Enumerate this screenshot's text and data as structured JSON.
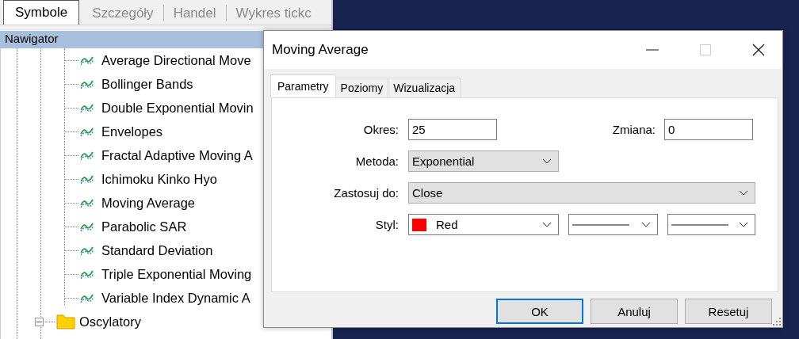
{
  "top_tabs": [
    {
      "label": "Symbole",
      "selected": true
    },
    {
      "label": "Szczegóły",
      "selected": false
    },
    {
      "label": "Handel",
      "selected": false
    },
    {
      "label": "Wykres tickc",
      "selected": false
    }
  ],
  "navigator": {
    "title": "Nawigator",
    "items": [
      {
        "kind": "indicator",
        "label": "Average Directional Move"
      },
      {
        "kind": "indicator",
        "label": "Bollinger Bands"
      },
      {
        "kind": "indicator",
        "label": "Double Exponential Movin"
      },
      {
        "kind": "indicator",
        "label": "Envelopes"
      },
      {
        "kind": "indicator",
        "label": "Fractal Adaptive Moving A"
      },
      {
        "kind": "indicator",
        "label": "Ichimoku Kinko Hyo"
      },
      {
        "kind": "indicator",
        "label": "Moving Average"
      },
      {
        "kind": "indicator",
        "label": "Parabolic SAR"
      },
      {
        "kind": "indicator",
        "label": "Standard Deviation"
      },
      {
        "kind": "indicator",
        "label": "Triple Exponential Moving"
      },
      {
        "kind": "indicator",
        "label": "Variable Index Dynamic A"
      },
      {
        "kind": "folder",
        "label": "Oscylatory",
        "expanded": true
      }
    ]
  },
  "dialog": {
    "title": "Moving Average",
    "tabs": [
      {
        "label": "Parametry",
        "selected": true
      },
      {
        "label": "Poziomy",
        "selected": false
      },
      {
        "label": "Wizualizacja",
        "selected": false
      }
    ],
    "period": {
      "label": "Okres:",
      "value": "25"
    },
    "shift": {
      "label": "Zmiana:",
      "value": "0"
    },
    "method": {
      "label": "Metoda:",
      "value": "Exponential"
    },
    "apply_to": {
      "label": "Zastosuj do:",
      "value": "Close"
    },
    "style": {
      "label": "Styl:",
      "color_name": "Red",
      "color": "#ff0000"
    },
    "buttons": [
      {
        "label": "OK",
        "focused": true
      },
      {
        "label": "Anuluj",
        "focused": false
      },
      {
        "label": "Resetuj",
        "focused": false
      }
    ]
  }
}
